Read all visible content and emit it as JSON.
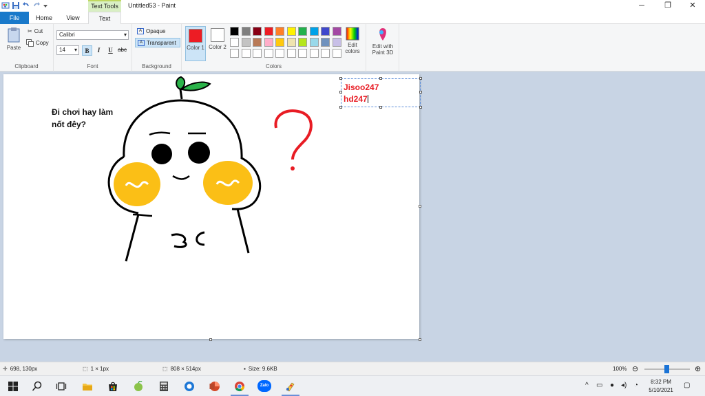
{
  "window": {
    "title": "Untitled53 - Paint",
    "context_tab_header": "Text Tools",
    "minimize_glyph": "─",
    "restore_glyph": "❐",
    "close_glyph": "✕"
  },
  "tabs": {
    "file": "File",
    "home": "Home",
    "view": "View",
    "text": "Text"
  },
  "ribbon": {
    "clipboard": {
      "label": "Clipboard",
      "paste": "Paste",
      "cut": "Cut",
      "copy": "Copy"
    },
    "font": {
      "label": "Font",
      "family": "Calibri",
      "size": "14",
      "bold": "B",
      "italic": "I",
      "underline": "U",
      "strike": "abc"
    },
    "background": {
      "label": "Background",
      "opaque": "Opaque",
      "transparent": "Transparent"
    },
    "colors": {
      "label": "Colors",
      "color1": "Color 1",
      "color2": "Color 2",
      "color1_value": "#ed1c24",
      "color2_value": "#ffffff",
      "edit_colors": "Edit colors",
      "row1": [
        "#000000",
        "#7f7f7f",
        "#880015",
        "#ed1c24",
        "#ff7f27",
        "#fff200",
        "#22b14c",
        "#00a2e8",
        "#3f48cc",
        "#a349a4"
      ],
      "row2": [
        "#ffffff",
        "#c3c3c3",
        "#b97a57",
        "#ffaec9",
        "#ffc90e",
        "#efe4b0",
        "#b5e61d",
        "#99d9ea",
        "#7092be",
        "#c8bfe7"
      ],
      "row3": [
        "#ffffff",
        "#ffffff",
        "#ffffff",
        "#ffffff",
        "#ffffff",
        "#ffffff",
        "#ffffff",
        "#ffffff",
        "#ffffff",
        "#ffffff"
      ]
    },
    "paint3d": {
      "label": "Edit with Paint 3D"
    }
  },
  "canvas": {
    "speech_text": "Đi chơi hay làm\nnốt đêy?",
    "textbox_line1": "Jisoo247",
    "textbox_line2": "hd247",
    "question_color": "#e81c24"
  },
  "status": {
    "cursor_pos": "698, 130px",
    "selection_size": "1 × 1px",
    "image_size": "808 × 514px",
    "file_size": "Size: 9.6KB",
    "zoom": "100%"
  },
  "taskbar": {
    "time": "8:32 PM",
    "date": "5/10/2021",
    "zalo_label": "Zalo"
  }
}
